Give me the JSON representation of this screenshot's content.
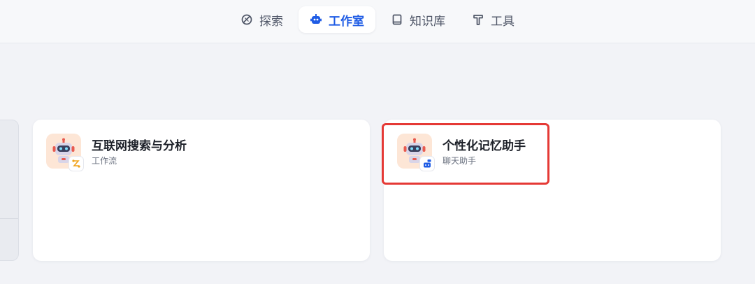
{
  "nav": {
    "tabs": [
      {
        "label": "探索",
        "icon": "compass-icon",
        "active": false
      },
      {
        "label": "工作室",
        "icon": "robot-icon",
        "active": true
      },
      {
        "label": "知识库",
        "icon": "book-icon",
        "active": false
      },
      {
        "label": "工具",
        "icon": "hammer-icon",
        "active": false
      }
    ]
  },
  "cards": [
    {
      "title": "互联网搜索与分析",
      "type": "工作流",
      "avatar_icon": "robot-avatar-icon",
      "badge_icon": "workflow-icon"
    },
    {
      "title": "个性化记忆助手",
      "type": "聊天助手",
      "avatar_icon": "robot-avatar-icon",
      "badge_icon": "chat-assistant-icon"
    }
  ],
  "colors": {
    "accent": "#1f5ce5",
    "highlight": "#e53935",
    "background": "#f2f3f7",
    "avatar_bg": "#fde6d6",
    "workflow_badge": "#f0a31a"
  }
}
